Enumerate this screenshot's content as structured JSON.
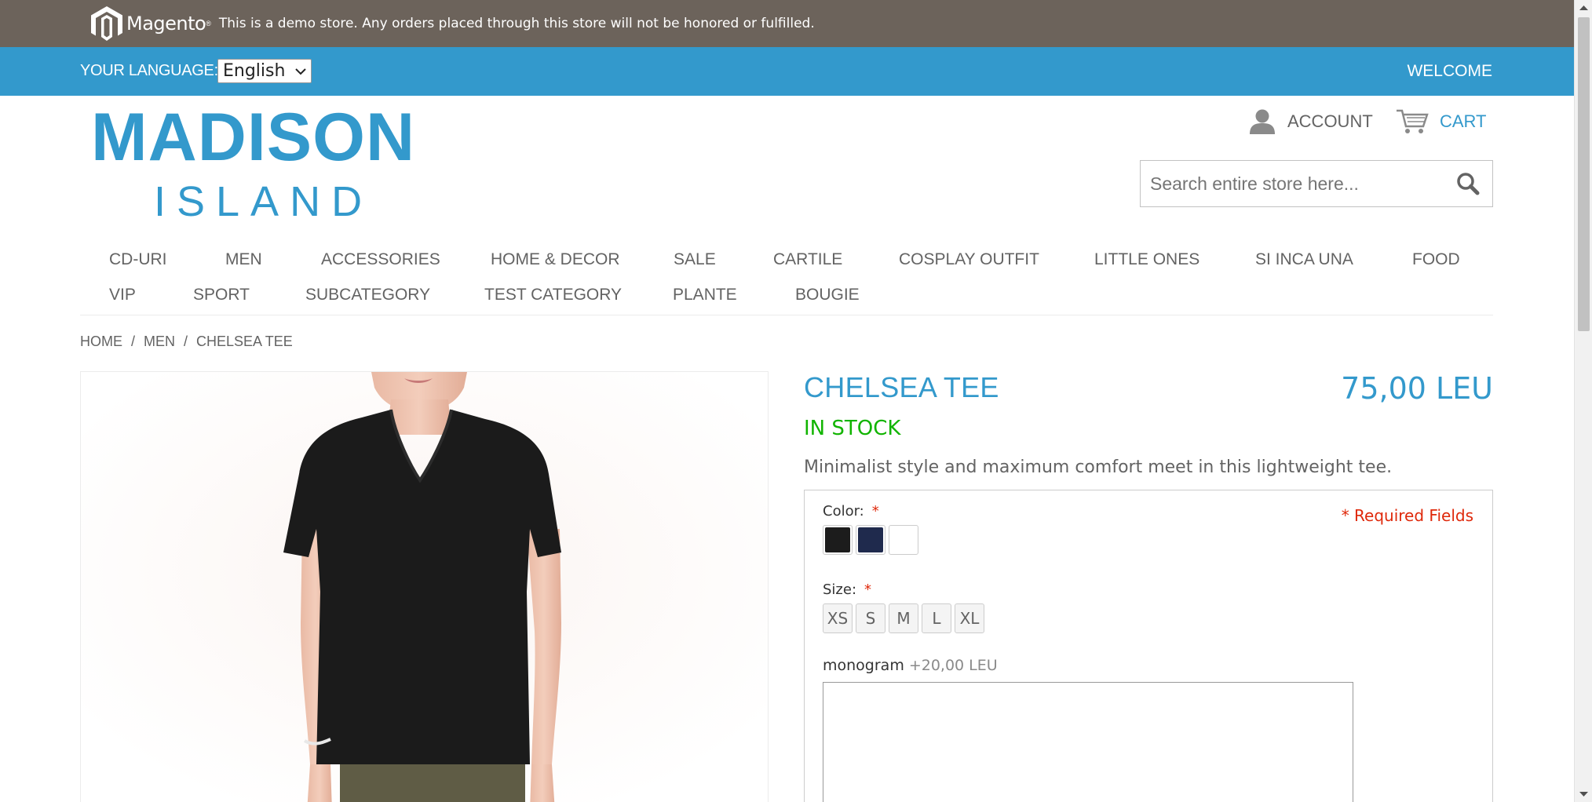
{
  "demo_notice": {
    "brand": "Magento",
    "text": "This is a demo store. Any orders placed through this store will not be honored or fulfilled."
  },
  "language_bar": {
    "label": "YOUR LANGUAGE:",
    "selected_language": "English",
    "welcome": "WELCOME"
  },
  "header": {
    "logo_main": "MADISON",
    "logo_sub": "ISLAND",
    "account_label": "ACCOUNT",
    "cart_label": "CART",
    "search_placeholder": "Search entire store here..."
  },
  "nav": {
    "items": [
      "CD-URI",
      "MEN",
      "ACCESSORIES",
      "HOME & DECOR",
      "SALE",
      "CARTILE",
      "COSPLAY OUTFIT",
      "LITTLE ONES",
      "SI INCA UNA",
      "FOOD",
      "VIP",
      "SPORT",
      "SUBCATEGORY",
      "TEST CATEGORY",
      "PLANTE",
      "BOUGIE"
    ]
  },
  "breadcrumb": {
    "items": [
      "HOME",
      "MEN",
      "CHELSEA TEE"
    ],
    "separator": "/"
  },
  "product": {
    "name": "CHELSEA TEE",
    "price": "75,00 LEU",
    "stock": "IN STOCK",
    "short_description": "Minimalist style and maximum comfort meet in this lightweight tee.",
    "required_fields": "* Required Fields",
    "color_label": "Color:",
    "size_label": "Size:",
    "required_mark": "*",
    "colors": [
      {
        "name": "black",
        "hex": "#1c1c1c"
      },
      {
        "name": "navy",
        "hex": "#1f2a4d"
      },
      {
        "name": "white",
        "hex": "#ffffff"
      }
    ],
    "sizes": [
      "XS",
      "S",
      "M",
      "L",
      "XL"
    ],
    "monogram_label": "monogram",
    "monogram_extra": "+20,00 LEU"
  },
  "colors": {
    "accent": "#3399cc",
    "demo_bar": "#6c635b",
    "in_stock": "#11b400",
    "required": "#df280a"
  }
}
